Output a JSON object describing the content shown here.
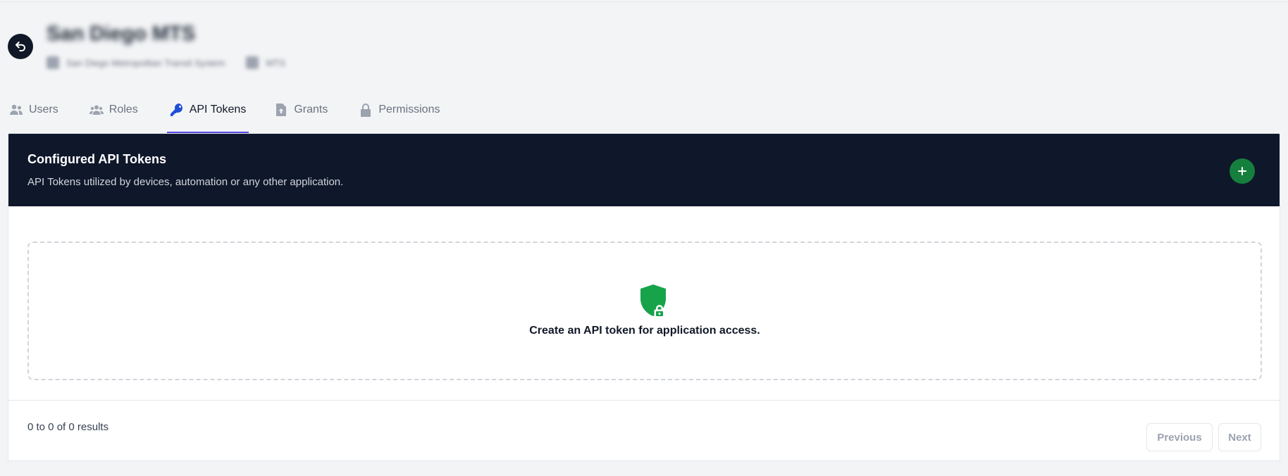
{
  "header": {
    "title": "San Diego MTS",
    "org_name": "San Diego Metropolitan Transit System",
    "org_code": "MTS",
    "back_icon": "undo-arrow-icon"
  },
  "tabs": [
    {
      "label": "Users",
      "icon": "users-icon",
      "active": false
    },
    {
      "label": "Roles",
      "icon": "user-group-icon",
      "active": false
    },
    {
      "label": "API Tokens",
      "icon": "key-icon",
      "active": true
    },
    {
      "label": "Grants",
      "icon": "document-arrow-up-icon",
      "active": false
    },
    {
      "label": "Permissions",
      "icon": "lock-icon",
      "active": false
    }
  ],
  "card": {
    "title": "Configured API Tokens",
    "description": "API Tokens utilized by devices, automation or any other application.",
    "add_icon": "plus-icon"
  },
  "empty_state": {
    "icon": "shield-lock-icon",
    "message": "Create an API token for application access."
  },
  "pagination": {
    "summary": "0 to 0 of 0 results",
    "previous_label": "Previous",
    "next_label": "Next"
  },
  "colors": {
    "header_bg": "#0f172a",
    "accent_green": "#16a34a",
    "add_button": "#15803d",
    "active_tab_underline": "#4f46e5",
    "active_tab_icon": "#1d4ed8",
    "page_bg": "#f3f4f6"
  }
}
